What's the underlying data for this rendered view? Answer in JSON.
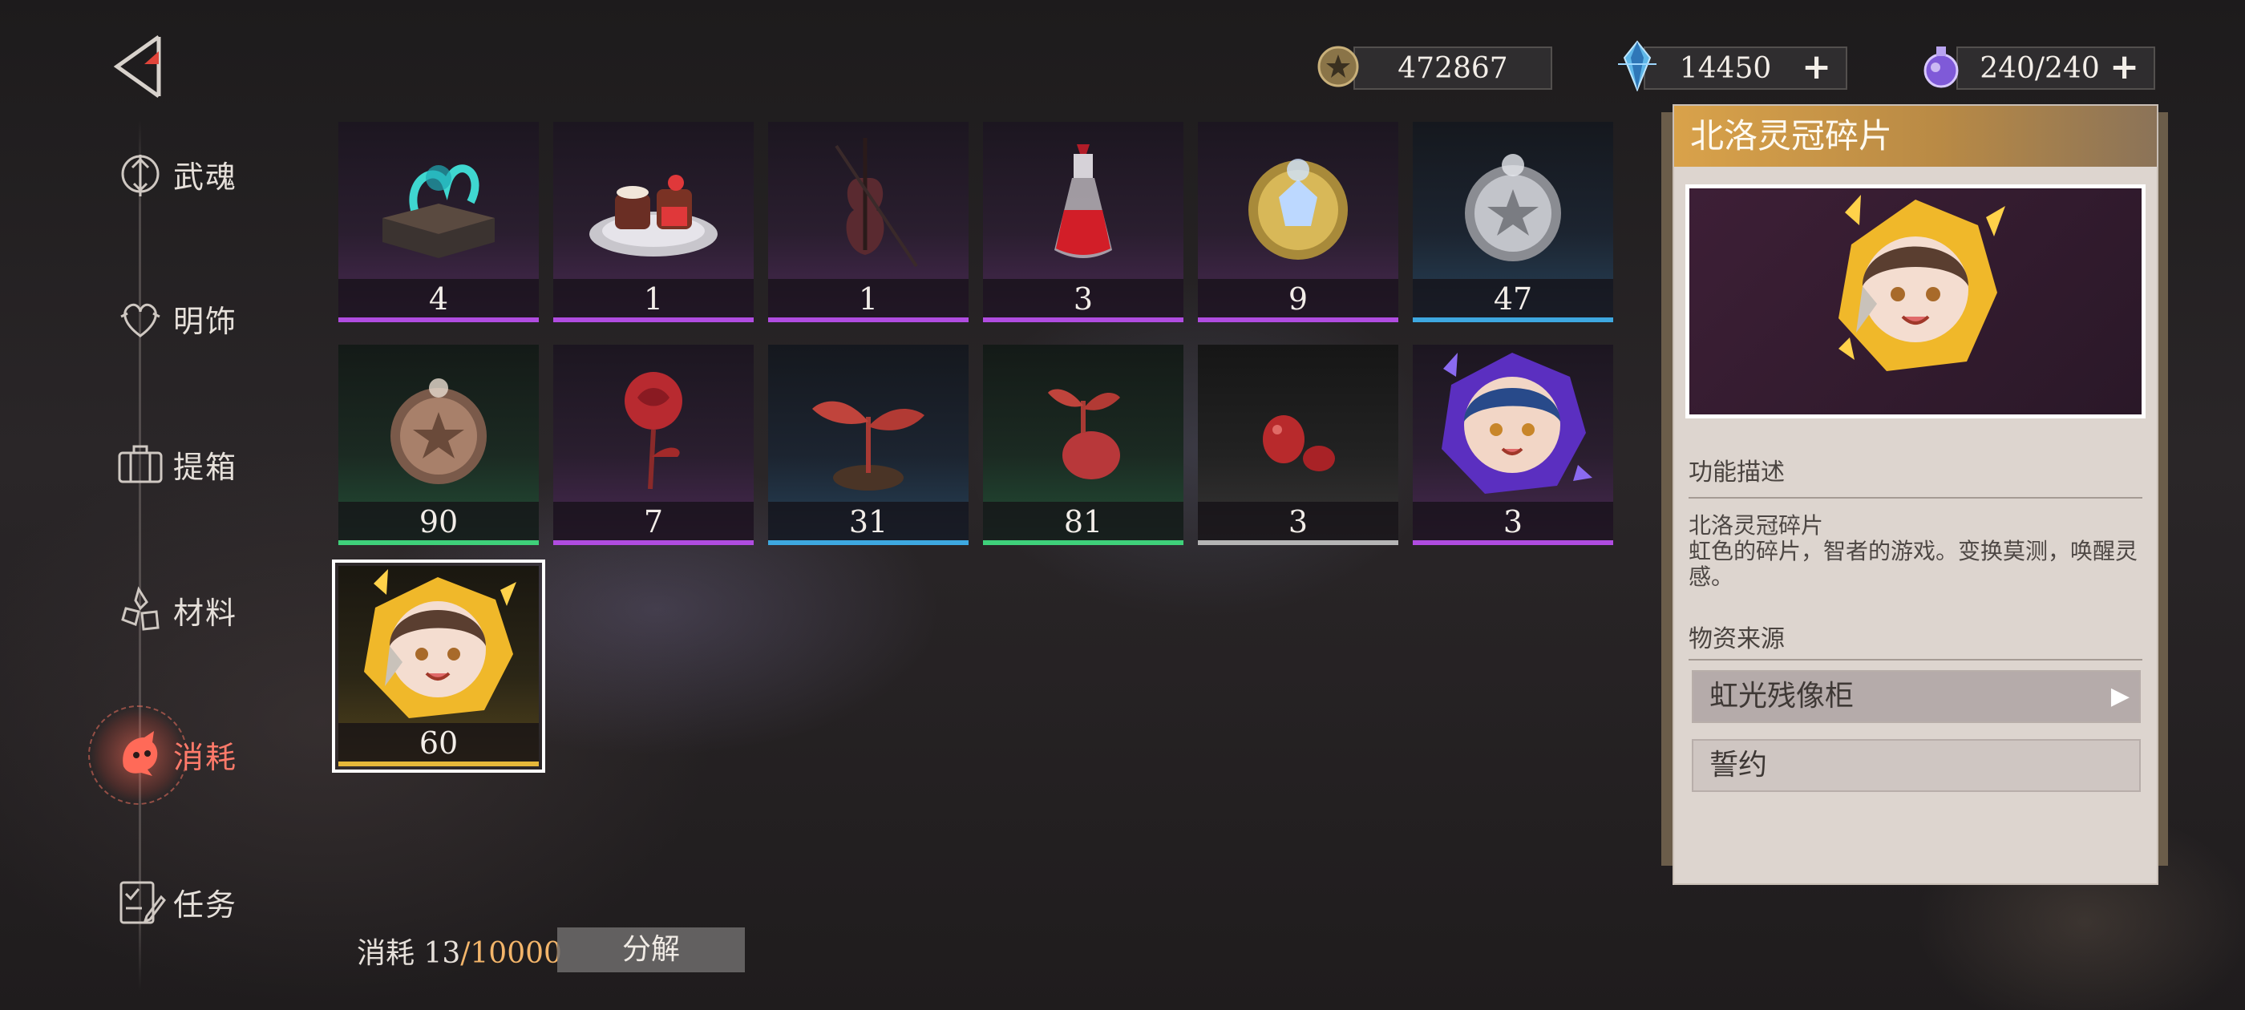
{
  "sidebar": {
    "items": [
      {
        "label": "武魂",
        "icon": "spirit-icon"
      },
      {
        "label": "明饰",
        "icon": "heart-ornament-icon"
      },
      {
        "label": "提箱",
        "icon": "suitcase-icon"
      },
      {
        "label": "材料",
        "icon": "material-icon"
      },
      {
        "label": "消耗",
        "icon": "consumable-icon",
        "active": true
      },
      {
        "label": "任务",
        "icon": "task-icon"
      }
    ]
  },
  "currencies": [
    {
      "value": "472867",
      "icon": "coin-icon"
    },
    {
      "value": "14450",
      "icon": "crystal-icon",
      "plus": "+"
    },
    {
      "value": "240/240",
      "icon": "stamina-potion-icon",
      "plus": "+"
    }
  ],
  "items": [
    {
      "name": "spellbook",
      "count": "4",
      "rarity": "purple"
    },
    {
      "name": "cake-plate",
      "count": "1",
      "rarity": "purple"
    },
    {
      "name": "violin",
      "count": "1",
      "rarity": "purple"
    },
    {
      "name": "red-potion",
      "count": "3",
      "rarity": "purple"
    },
    {
      "name": "gold-medal",
      "count": "9",
      "rarity": "purple"
    },
    {
      "name": "silver-medal",
      "count": "47",
      "rarity": "blue"
    },
    {
      "name": "bronze-medal",
      "count": "90",
      "rarity": "green"
    },
    {
      "name": "red-rose",
      "count": "7",
      "rarity": "purple"
    },
    {
      "name": "red-sprout-large",
      "count": "31",
      "rarity": "blue"
    },
    {
      "name": "red-sprout-seed",
      "count": "81",
      "rarity": "green"
    },
    {
      "name": "red-beans",
      "count": "3",
      "rarity": "gray"
    },
    {
      "name": "character-shard-blue",
      "count": "3",
      "rarity": "purple"
    },
    {
      "name": "character-shard-gold",
      "count": "60",
      "rarity": "gold",
      "selected": true
    }
  ],
  "footer": {
    "consume_label": "消耗 13",
    "consume_max": "/10000",
    "decompose_label": "分解"
  },
  "detail": {
    "title": "北洛灵冠碎片",
    "func_heading": "功能描述",
    "desc_name": "北洛灵冠碎片",
    "desc_text": "虹色的碎片，智者的游戏。变换莫测，唤醒灵感。",
    "source_heading": "物资来源",
    "sources": [
      "虹光残像柜",
      "誓约"
    ],
    "arrow": "▶"
  },
  "colors": {
    "purple": "#b04ce0",
    "blue": "#3ea8e0",
    "green": "#3fd07a",
    "gray": "#b5b5b5",
    "gold": "#e6b83a",
    "active_tab": "#ff7a6a"
  }
}
